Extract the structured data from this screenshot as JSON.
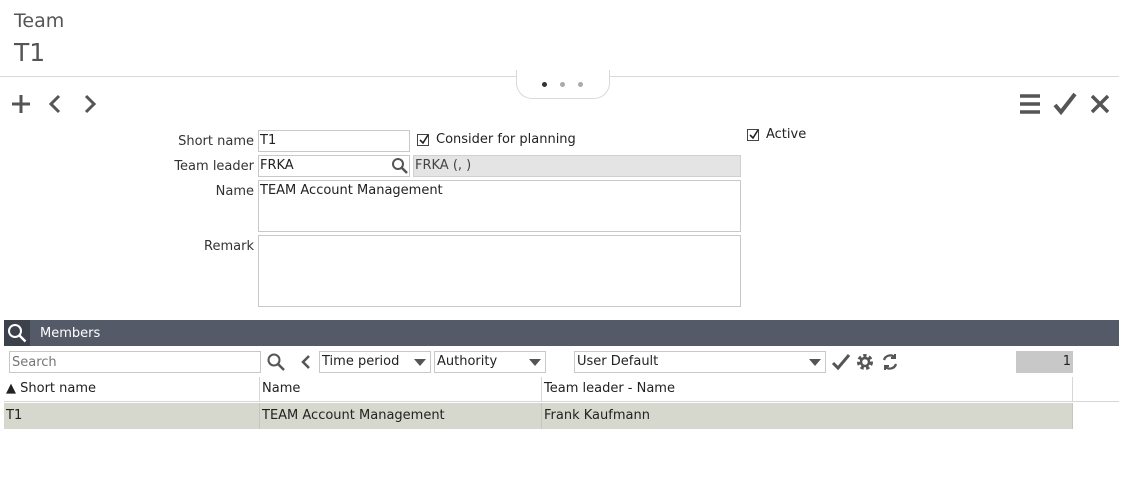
{
  "header": {
    "subtitle": "Team",
    "title": "T1"
  },
  "pager": {
    "dots": 3,
    "active": 0
  },
  "toolbar": {
    "left_icons": [
      "plus-icon",
      "chevron-left-icon",
      "chevron-right-icon"
    ],
    "right_icons": [
      "menu-icon",
      "checkmark-icon",
      "close-icon"
    ]
  },
  "form": {
    "short_name_label": "Short name",
    "short_name_value": "T1",
    "consider_label": "Consider for planning",
    "consider_checked": true,
    "active_label": "Active",
    "active_checked": true,
    "team_leader_label": "Team leader",
    "team_leader_value": "FRKA",
    "team_leader_display": "FRKA (, )",
    "name_label": "Name",
    "name_value": "TEAM Account Management",
    "remark_label": "Remark",
    "remark_value": ""
  },
  "members": {
    "title": "Members",
    "search_placeholder": "Search",
    "time_period": "Time period",
    "authority": "Authority",
    "layout": "User Default",
    "count": "1",
    "columns": [
      "▲ Short name",
      "Name",
      "Team leader - Name"
    ],
    "rows": [
      {
        "short_name": "T1",
        "name": "TEAM Account Management",
        "leader": "Frank Kaufmann"
      }
    ]
  },
  "colors": {
    "bar": "#555a68",
    "bar_dark": "#3d414c",
    "row_selected": "#d7d8cd",
    "readonly": "#e4e4e4"
  }
}
